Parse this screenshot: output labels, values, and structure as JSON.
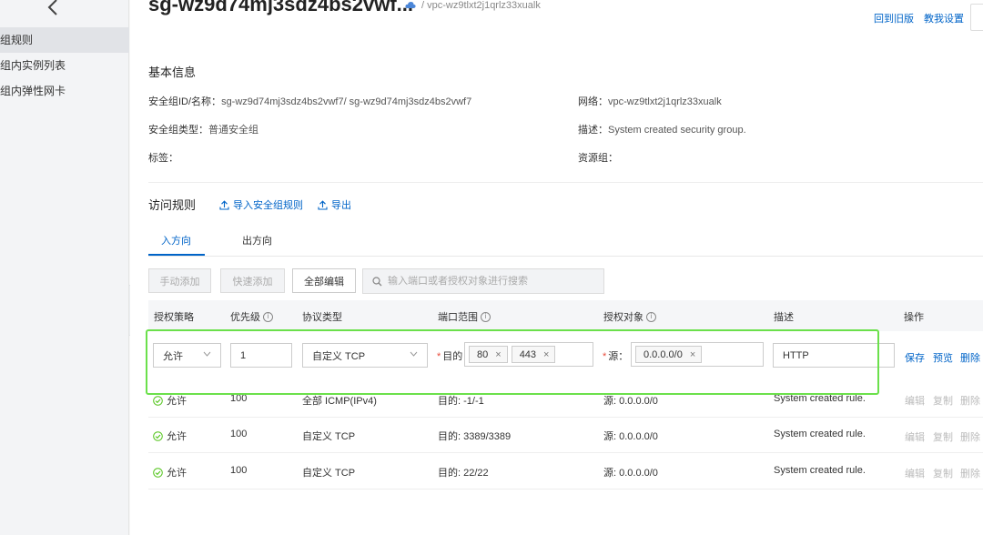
{
  "sidebar": {
    "items": [
      {
        "label": "组规则"
      },
      {
        "label": "组内实例列表"
      },
      {
        "label": "组内弹性网卡"
      }
    ]
  },
  "header": {
    "title": "sg-wz9d74mj3sdz4bs2vwf...",
    "vpc_path": "/ vpc-wz9tlxt2j1qrlz33xualk",
    "back_to_old": "回到旧版",
    "tutorial": "教我设置"
  },
  "basic_info": {
    "title": "基本信息",
    "sg_id_label": "安全组ID/名称：",
    "sg_id_value": "sg-wz9d74mj3sdz4bs2vwf7/ sg-wz9d74mj3sdz4bs2vwf7",
    "network_label": "网络：",
    "network_value": "vpc-wz9tlxt2j1qrlz33xualk",
    "type_label": "安全组类型：",
    "type_value": "普通安全组",
    "desc_label": "描述：",
    "desc_value": "System created security group.",
    "tag_label": "标签：",
    "resource_group_label": "资源组："
  },
  "access_rules": {
    "title": "访问规则",
    "import_label": "导入安全组规则",
    "export_label": "导出"
  },
  "tabs": [
    {
      "label": "入方向"
    },
    {
      "label": "出方向"
    }
  ],
  "toolbar": {
    "manual_add": "手动添加",
    "quick_add": "快速添加",
    "edit_all": "全部编辑",
    "search_placeholder": "输入端口或者授权对象进行搜索"
  },
  "table": {
    "headers": {
      "policy": "授权策略",
      "priority": "优先级",
      "protocol": "协议类型",
      "port_range": "端口范围",
      "auth_object": "授权对象",
      "description": "描述",
      "actions": "操作"
    },
    "edit_row": {
      "policy": "允许",
      "priority": "1",
      "protocol": "自定义 TCP",
      "dest_label": "目的",
      "ports": [
        "80",
        "443"
      ],
      "source_label": "源",
      "source": "0.0.0.0/0",
      "description": "HTTP",
      "save": "保存",
      "preview": "预览",
      "delete": "删除"
    },
    "rows": [
      {
        "policy": "允许",
        "priority": "100",
        "protocol": "全部 ICMP(IPv4)",
        "port": "目的: -1/-1",
        "source": "源: 0.0.0.0/0",
        "desc": "System created rule.",
        "edit": "编辑",
        "copy": "复制",
        "delete": "删除"
      },
      {
        "policy": "允许",
        "priority": "100",
        "protocol": "自定义 TCP",
        "port": "目的: 3389/3389",
        "source": "源: 0.0.0.0/0",
        "desc": "System created rule.",
        "edit": "编辑",
        "copy": "复制",
        "delete": "删除"
      },
      {
        "policy": "允许",
        "priority": "100",
        "protocol": "自定义 TCP",
        "port": "目的: 22/22",
        "source": "源: 0.0.0.0/0",
        "desc": "System created rule.",
        "edit": "编辑",
        "copy": "复制",
        "delete": "删除"
      }
    ]
  },
  "colors": {
    "accent": "#0064c8",
    "highlight_box": "#6be04b",
    "success": "#52c41a",
    "required": "#e84a3a"
  }
}
